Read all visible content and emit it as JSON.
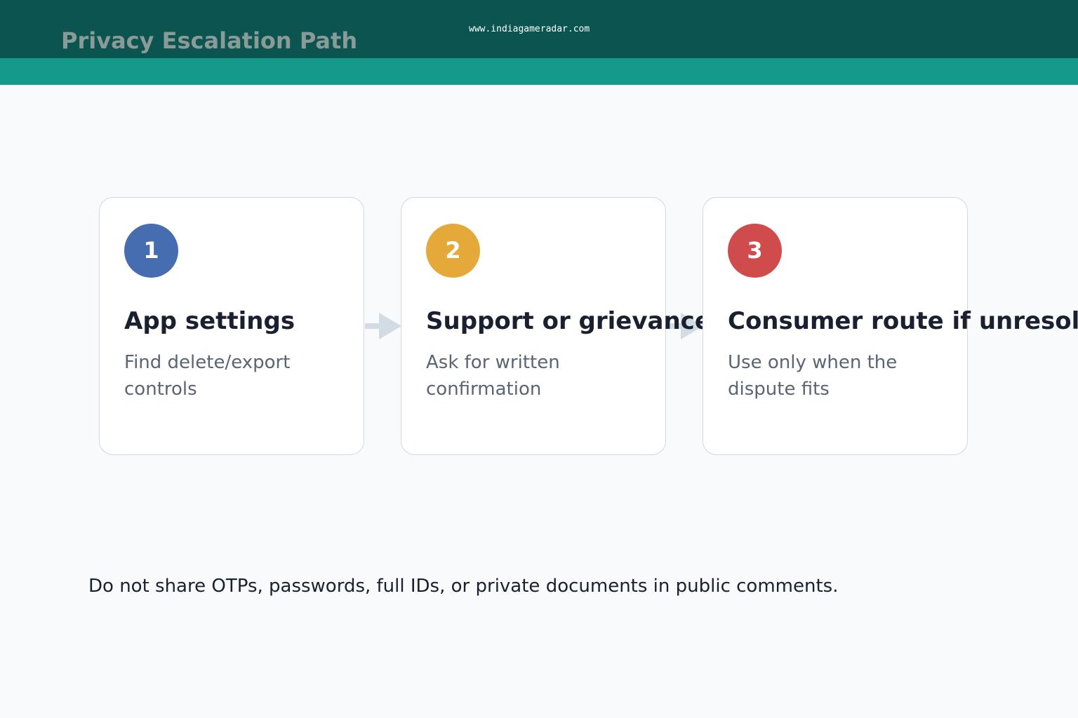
{
  "header": {
    "title": "Privacy Escalation Path",
    "watermark": "www.indiagameradar.com"
  },
  "steps": [
    {
      "number": "1",
      "title": "App settings",
      "description": "Find delete/export controls",
      "badge_color": "#456db0"
    },
    {
      "number": "2",
      "title": "Support or grievance",
      "description": "Ask for written confirmation",
      "badge_color": "#e5a93a"
    },
    {
      "number": "3",
      "title": "Consumer route if unresolved",
      "description": "Use only when the dispute fits",
      "badge_color": "#d04b4b"
    }
  ],
  "footnote": "Do not share OTPs, passwords, full IDs, or private documents in public comments.",
  "colors": {
    "header_bg": "#0b5450",
    "accent_band": "#14998a",
    "arrow": "#d3dbe4",
    "card_border": "#d3d9e1",
    "page_bg": "#f8fafc"
  }
}
